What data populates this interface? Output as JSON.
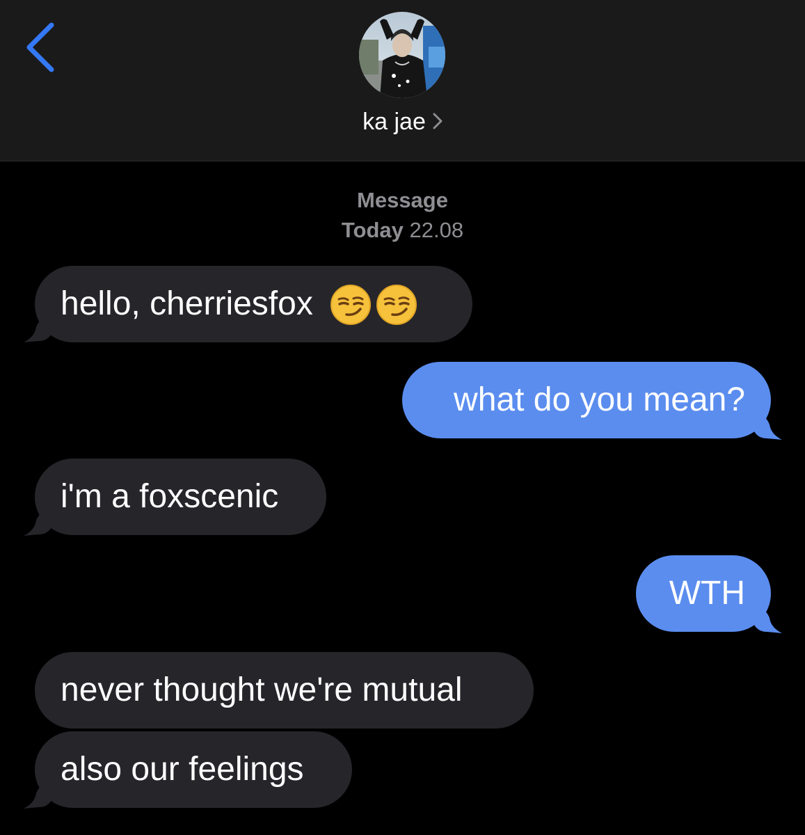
{
  "header": {
    "back_icon": "chevron-left-icon",
    "contact_name": "ka jae",
    "contact_chevron_icon": "chevron-right-icon",
    "avatar_icon": "contact-avatar-photo",
    "accent_color": "#3478f6"
  },
  "thread": {
    "service_label": "Message",
    "day_label": "Today",
    "time_label": "22.08"
  },
  "messages": [
    {
      "direction": "received",
      "text": "hello, cherriesfox",
      "emoji": [
        "smirking-face-emoji",
        "smirking-face-emoji"
      ]
    },
    {
      "direction": "sent",
      "text": "what do you mean?"
    },
    {
      "direction": "received",
      "text": "i'm a foxscenic"
    },
    {
      "direction": "sent",
      "text": "WTH"
    },
    {
      "direction": "received",
      "text": "never thought we're mutual"
    },
    {
      "direction": "received",
      "text": "also our feelings"
    }
  ],
  "colors": {
    "background": "#000000",
    "header_background": "#1a1a1a",
    "received_bubble": "#26252a",
    "sent_bubble": "#5b8def",
    "meta_text": "#8e8e93"
  }
}
